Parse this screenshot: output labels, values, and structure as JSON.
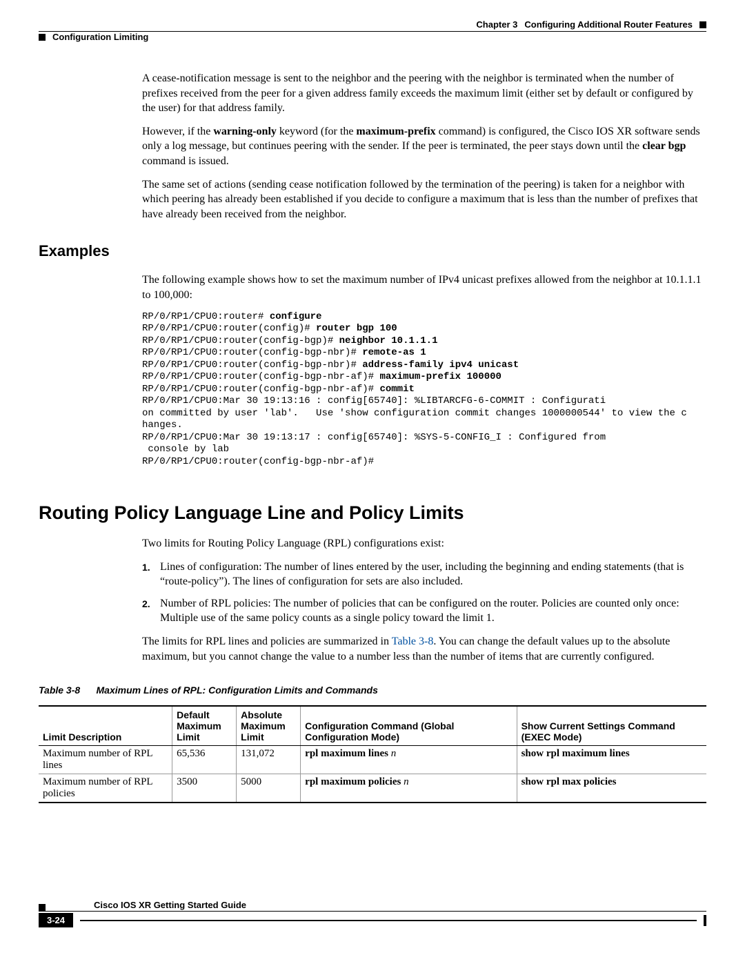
{
  "header": {
    "section": "Configuration Limiting",
    "chapter_label": "Chapter 3",
    "chapter_title": "Configuring Additional Router Features"
  },
  "para1_a": "A cease-notification message is sent to the neighbor and the peering with the neighbor is terminated when the number of prefixes received from the peer for a given address family exceeds the maximum limit (either set by default or configured by the user) for that address family.",
  "para2_a": "However, if the ",
  "para2_b": "warning-only",
  "para2_c": " keyword (for the ",
  "para2_d": "maximum-prefix",
  "para2_e": " command) is configured, the Cisco IOS XR software sends only a log message, but continues peering with the sender. If the peer is terminated, the peer stays down until the ",
  "para2_f": "clear bgp",
  "para2_g": " command is issued.",
  "para3": "The same set of actions (sending cease notification followed by the termination of the peering) is taken for a neighbor with which peering has already been established if you decide to configure a maximum that is less than the number of prefixes that have already been received from the neighbor.",
  "examples_heading": "Examples",
  "examples_intro": "The following example shows how to set the maximum number of IPv4 unicast prefixes allowed from the neighbor at 10.1.1.1 to 100,000:",
  "code": {
    "l1a": "RP/0/RP1/CPU0:router# ",
    "l1b": "configure",
    "l2a": "RP/0/RP1/CPU0:router(config)# ",
    "l2b": "router bgp 100",
    "l3a": "RP/0/RP1/CPU0:router(config-bgp)# ",
    "l3b": "neighbor 10.1.1.1",
    "l4a": "RP/0/RP1/CPU0:router(config-bgp-nbr)# ",
    "l4b": "remote-as 1",
    "l5a": "RP/0/RP1/CPU0:router(config-bgp-nbr)# ",
    "l5b": "address-family ipv4 unicast",
    "l6a": "RP/0/RP1/CPU0:router(config-bgp-nbr-af)# ",
    "l6b": "maximum-prefix 100000",
    "l7a": "RP/0/RP1/CPU0:router(config-bgp-nbr-af)# ",
    "l7b": "commit",
    "l8": "RP/0/RP1/CPU0:Mar 30 19:13:16 : config[65740]: %LIBTARCFG-6-COMMIT : Configurati",
    "l9": "on committed by user 'lab'.   Use 'show configuration commit changes 1000000544' to view the c",
    "l10": "hanges.",
    "l11": "RP/0/RP1/CPU0:Mar 30 19:13:17 : config[65740]: %SYS-5-CONFIG_I : Configured from",
    "l12": " console by lab",
    "l13": "RP/0/RP1/CPU0:router(config-bgp-nbr-af)#"
  },
  "rpl_heading": "Routing Policy Language Line and Policy Limits",
  "rpl_intro": "Two limits for Routing Policy Language (RPL) configurations exist:",
  "rpl_item1": "Lines of configuration: The number of lines entered by the user, including the beginning and ending statements (that is “route-policy”). The lines of configuration for sets are also included.",
  "rpl_item2": "Number of RPL policies: The number of policies that can be configured on the router. Policies are counted only once: Multiple use of the same policy counts as a single policy toward the limit 1.",
  "rpl_summary_a": "The limits for RPL lines and policies are summarized in ",
  "rpl_summary_link": "Table 3-8",
  "rpl_summary_b": ". You can change the default values up to the absolute maximum, but you cannot change the value to a number less than the number of items that are currently configured.",
  "table_caption_num": "Table 3-8",
  "table_caption_title": "Maximum Lines of RPL: Configuration Limits and Commands",
  "table": {
    "headers": {
      "c1": "Limit Description",
      "c2": "Default Maximum Limit",
      "c3": "Absolute Maximum Limit",
      "c4": "Configuration Command (Global Configuration Mode)",
      "c5": "Show Current Settings Command (EXEC Mode)"
    },
    "rows": [
      {
        "desc": "Maximum number of RPL lines",
        "def": "65,536",
        "abs": "131,072",
        "cmd": "rpl maximum lines ",
        "cmd_var": "n",
        "show": "show rpl maximum lines"
      },
      {
        "desc": "Maximum number of RPL policies",
        "def": "3500",
        "abs": "5000",
        "cmd": "rpl maximum policies ",
        "cmd_var": "n",
        "show": "show rpl max policies"
      }
    ]
  },
  "footer": {
    "guide": "Cisco IOS XR Getting Started Guide",
    "page": "3-24"
  }
}
